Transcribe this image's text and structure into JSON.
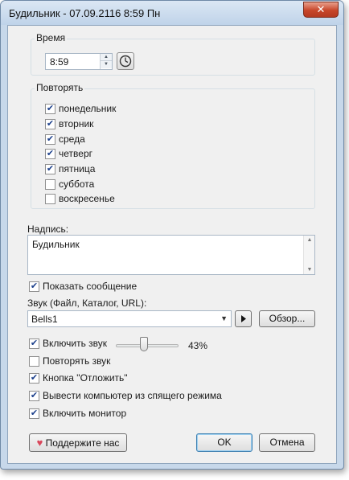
{
  "window": {
    "title": "Будильник - 07.09.2116 8:59 Пн",
    "close_label": "✕"
  },
  "time_group": {
    "label": "Время",
    "value": "8:59"
  },
  "repeat_group": {
    "label": "Повторять",
    "days": [
      {
        "label": "понедельник",
        "checked": true
      },
      {
        "label": "вторник",
        "checked": true
      },
      {
        "label": "среда",
        "checked": true
      },
      {
        "label": "четверг",
        "checked": true
      },
      {
        "label": "пятница",
        "checked": true
      },
      {
        "label": "суббота",
        "checked": false
      },
      {
        "label": "воскресенье",
        "checked": false
      }
    ]
  },
  "caption": {
    "label": "Надпись:",
    "value": "Будильник"
  },
  "show_message": {
    "label": "Показать сообщение",
    "checked": true
  },
  "sound": {
    "label": "Звук (Файл, Каталог, URL):",
    "value": "Bells1",
    "browse_label": "Обзор..."
  },
  "options": {
    "enable_sound": {
      "label": "Включить звук",
      "checked": true
    },
    "volume": "43%",
    "repeat_sound": {
      "label": "Повторять звук",
      "checked": false
    },
    "snooze_button": {
      "label": "Кнопка \"Отложить\"",
      "checked": true
    },
    "wake_computer": {
      "label": "Вывести компьютер из спящего режима",
      "checked": true
    },
    "enable_monitor": {
      "label": "Включить монитор",
      "checked": true
    }
  },
  "footer": {
    "support_label": "Поддержите нас",
    "ok_label": "OK",
    "cancel_label": "Отмена"
  },
  "colors": {
    "window_frame": "#c7d8ea",
    "dialog_bg": "#f0f0f0",
    "check_color": "#1b3f8b",
    "ok_border": "#3c7fb1"
  }
}
